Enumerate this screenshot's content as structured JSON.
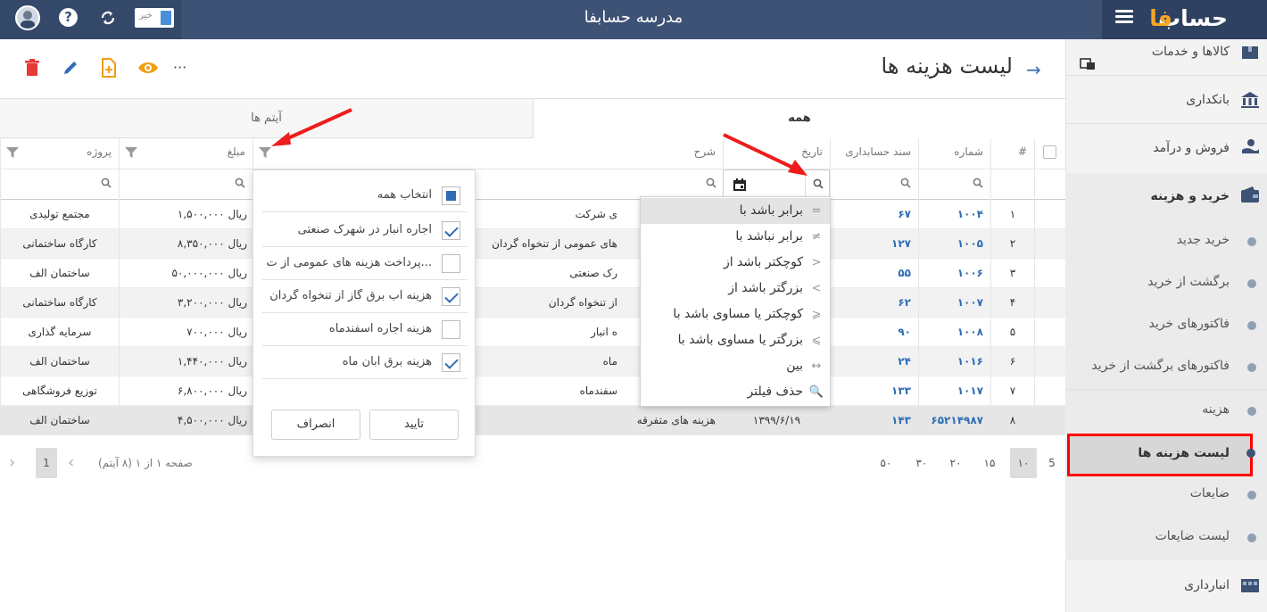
{
  "header": {
    "app_title": "مدرسه حسابفا",
    "toggle_label": "خیر",
    "logo_text": "حساب فا"
  },
  "sidebar": {
    "items": [
      {
        "label": "کالاها و خدمات"
      },
      {
        "label": "بانکداری"
      },
      {
        "label": "فروش و درآمد"
      },
      {
        "label": "خرید و هزینه"
      },
      {
        "label": "انبارداری"
      }
    ],
    "sub_items": [
      {
        "label": "خرید جدید"
      },
      {
        "label": "برگشت از خرید"
      },
      {
        "label": "فاکتورهای خرید"
      },
      {
        "label": "فاکتورهای برگشت از خرید"
      },
      {
        "label": "هزینه"
      },
      {
        "label": "لیست هزینه ها"
      },
      {
        "label": "ضایعات"
      },
      {
        "label": "لیست ضایعات"
      }
    ]
  },
  "page": {
    "title": "لیست هزینه ها",
    "more_label": "···"
  },
  "tabs": [
    {
      "label": "همه"
    },
    {
      "label": "آیتم ها"
    }
  ],
  "grid": {
    "columns": [
      "#",
      "شماره",
      "سند حسابداری",
      "تاریخ",
      "شرح",
      "مبلغ",
      "پروژه"
    ],
    "rows": [
      {
        "idx": "۱",
        "num": "۱۰۰۴",
        "doc": "۶۷",
        "date": "",
        "desc": "ی شرکت",
        "amount": "۱,۵۰۰,۰۰۰ ریال",
        "project": "مجتمع تولیدی"
      },
      {
        "idx": "۲",
        "num": "۱۰۰۵",
        "doc": "۱۲۷",
        "date": "",
        "desc": "های عمومی از تنخواه گردان",
        "amount": "۸,۳۵۰,۰۰۰ ریال",
        "project": "کارگاه ساختمانی"
      },
      {
        "idx": "۳",
        "num": "۱۰۰۶",
        "doc": "۵۵",
        "date": "",
        "desc": "رک صنعتی",
        "amount": "۵۰,۰۰۰,۰۰۰ ریال",
        "project": "ساختمان الف"
      },
      {
        "idx": "۴",
        "num": "۱۰۰۷",
        "doc": "۶۲",
        "date": "",
        "desc": "از تنخواه گردان",
        "amount": "۳,۲۰۰,۰۰۰ ریال",
        "project": "کارگاه ساختمانی"
      },
      {
        "idx": "۵",
        "num": "۱۰۰۸",
        "doc": "۹۰",
        "date": "",
        "desc": "ه انبار",
        "amount": "۷۰۰,۰۰۰ ریال",
        "project": "سرمایه گذاری"
      },
      {
        "idx": "۶",
        "num": "۱۰۱۶",
        "doc": "۲۴",
        "date": "",
        "desc": "ماه",
        "amount": "۱,۴۴۰,۰۰۰ ریال",
        "project": "ساختمان الف"
      },
      {
        "idx": "۷",
        "num": "۱۰۱۷",
        "doc": "۱۳۳",
        "date": "",
        "desc": "سفندماه",
        "amount": "۶,۸۰۰,۰۰۰ ریال",
        "project": "توزیع فروشگاهی"
      },
      {
        "idx": "۸",
        "num": "۶۵۲۱۴۹۸۷",
        "doc": "۱۴۳",
        "date": "۱۳۹۹/۶/۱۹",
        "desc": "هزینه های متفرقه",
        "amount": "۴,۵۰۰,۰۰۰ ریال",
        "project": "ساختمان الف"
      }
    ]
  },
  "pager": {
    "sizes": [
      "5",
      "۱۰",
      "۱۵",
      "۲۰",
      "۳۰",
      "۵۰"
    ],
    "info": "صفحه ۱ از ۱ (۸ آیتم)",
    "current": "1"
  },
  "operator_menu": {
    "items": [
      {
        "label": "برابر باشد با",
        "symbol": "="
      },
      {
        "label": "برابر نباشد با",
        "symbol": "≠"
      },
      {
        "label": "کوچکتر باشد از",
        "symbol": ">"
      },
      {
        "label": "بزرگتر باشد از",
        "symbol": "<"
      },
      {
        "label": "کوچکتر یا مساوی باشد با",
        "symbol": "⩾"
      },
      {
        "label": "بزرگتر یا مساوی باشد با",
        "symbol": "⩽"
      },
      {
        "label": "بین",
        "symbol": "↔"
      },
      {
        "label": "حذف فیلتر",
        "symbol": "🔍"
      }
    ]
  },
  "header_filter": {
    "select_all": "انتخاب همه",
    "items": [
      {
        "label": "اجاره انبار در شهرک صنعتی",
        "checked": true
      },
      {
        "label": "پرداخت هزینه های عمومی از ت...",
        "checked": false
      },
      {
        "label": "هزینه آب برق گاز از تنخواه گردان",
        "checked": true
      },
      {
        "label": "هزینه اجاره اسفندماه",
        "checked": false
      },
      {
        "label": "هزینه برق آبان ماه",
        "checked": true
      }
    ],
    "ok": "تایید",
    "cancel": "انصراف"
  },
  "colors": {
    "topbar": "#3d5275",
    "link": "#2f6db6",
    "highlight": "#ff0000"
  }
}
